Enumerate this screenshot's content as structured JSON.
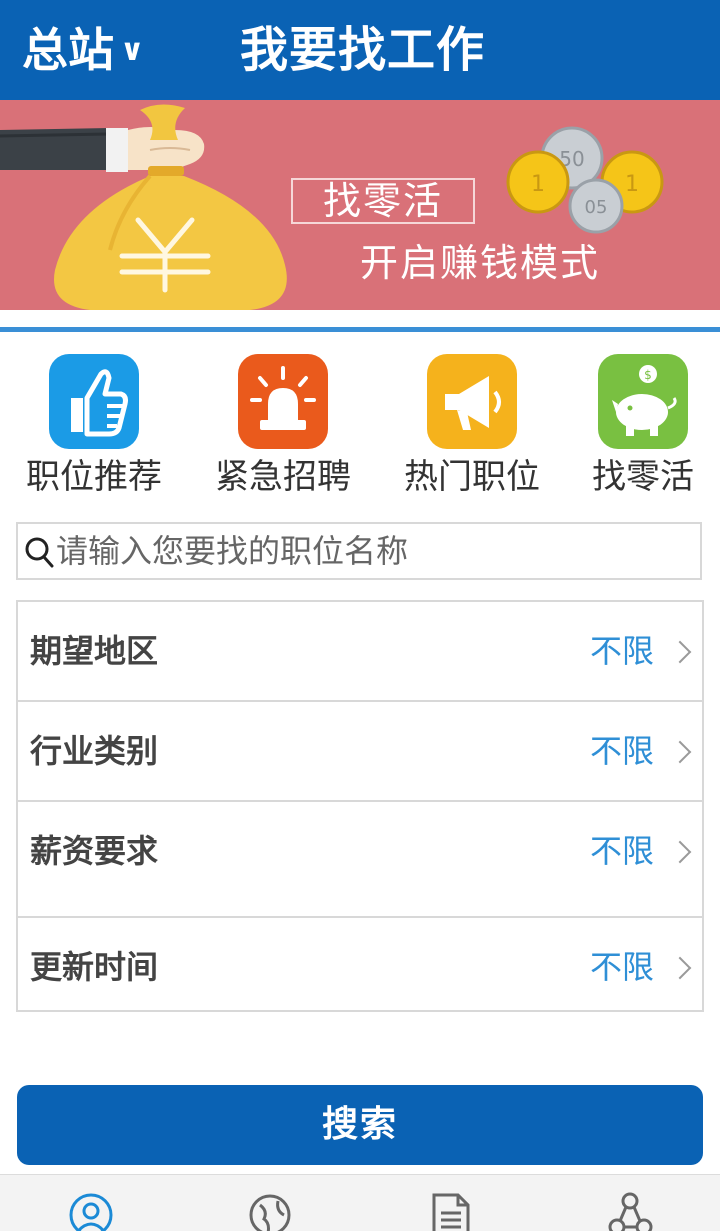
{
  "header": {
    "station": "总站",
    "station_chevron": "∨",
    "title": "我要找工作"
  },
  "banner": {
    "tag": "找零活",
    "slogan": "开启赚钱模式",
    "coin_labels": [
      "50",
      "1",
      "1",
      "05"
    ]
  },
  "categories": [
    {
      "label": "职位推荐",
      "icon": "thumbs-up-icon",
      "color": "#1b9be6"
    },
    {
      "label": "紧急招聘",
      "icon": "siren-icon",
      "color": "#ea5a1c"
    },
    {
      "label": "热门职位",
      "icon": "megaphone-icon",
      "color": "#f5b21c"
    },
    {
      "label": "找零活",
      "icon": "piggy-bank-icon",
      "color": "#79c041"
    }
  ],
  "search": {
    "placeholder": "请输入您要找的职位名称",
    "value": ""
  },
  "filters": [
    {
      "label": "期望地区",
      "value": "不限"
    },
    {
      "label": "行业类别",
      "value": "不限"
    },
    {
      "label": "薪资要求",
      "value": "不限"
    },
    {
      "label": "更新时间",
      "value": "不限"
    }
  ],
  "search_button": "搜索",
  "bottom_nav": [
    {
      "icon": "user-icon"
    },
    {
      "icon": "globe-icon"
    },
    {
      "icon": "document-icon"
    },
    {
      "icon": "network-icon"
    }
  ],
  "colors": {
    "primary": "#0a62b4",
    "accent_blue": "#2f8fd6",
    "banner_bg": "#d97178"
  }
}
